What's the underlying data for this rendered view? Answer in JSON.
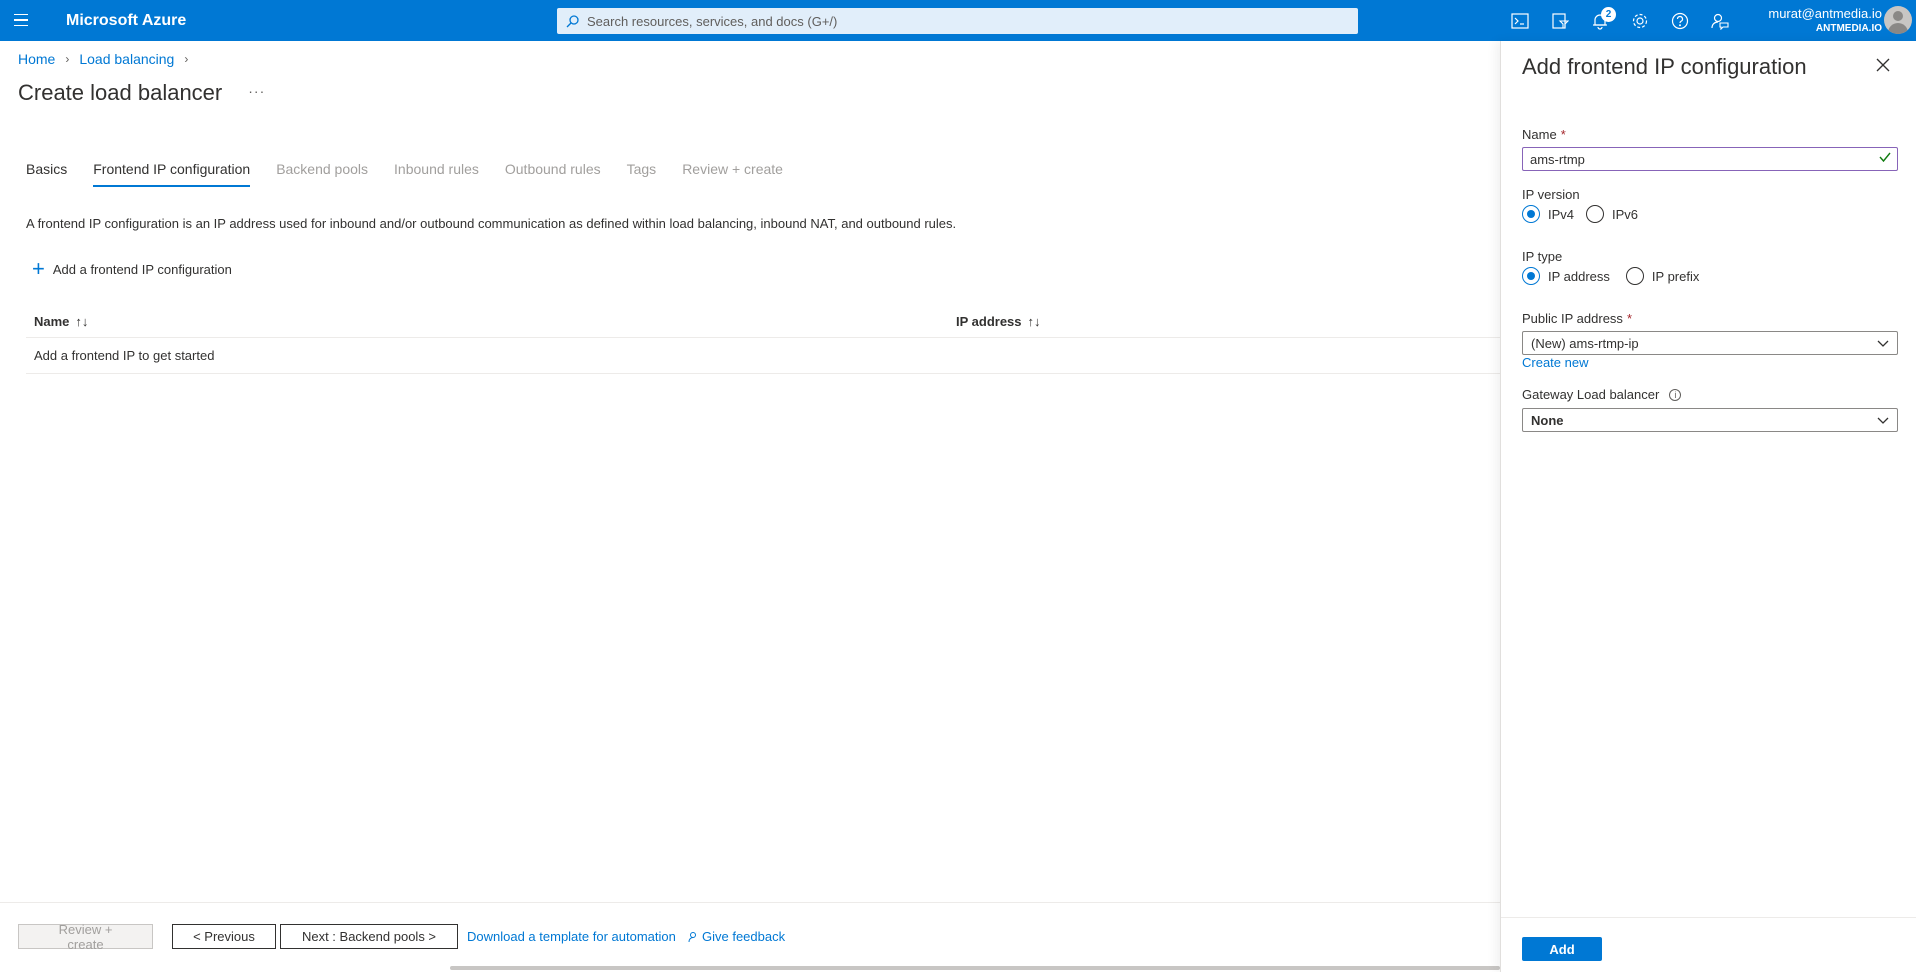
{
  "topbar": {
    "brand": "Microsoft Azure",
    "search_placeholder": "Search resources, services, and docs (G+/)",
    "notification_count": "2",
    "account_email": "murat@antmedia.io",
    "account_org": "ANTMEDIA.IO",
    "icons": [
      "cloud-shell-icon",
      "directory-filter-icon",
      "notifications-icon",
      "settings-icon",
      "help-icon",
      "feedback-icon"
    ]
  },
  "breadcrumb": {
    "items": [
      "Home",
      "Load balancing"
    ]
  },
  "page": {
    "title": "Create load balancer",
    "more": "···"
  },
  "tabs": [
    {
      "label": "Basics",
      "state": "enabled"
    },
    {
      "label": "Frontend IP configuration",
      "state": "active"
    },
    {
      "label": "Backend pools",
      "state": "disabled"
    },
    {
      "label": "Inbound rules",
      "state": "disabled"
    },
    {
      "label": "Outbound rules",
      "state": "disabled"
    },
    {
      "label": "Tags",
      "state": "disabled"
    },
    {
      "label": "Review + create",
      "state": "disabled"
    }
  ],
  "main": {
    "description": "A frontend IP configuration is an IP address used for inbound and/or outbound communication as defined within load balancing, inbound NAT, and outbound rules.",
    "add_label": "Add a frontend IP configuration",
    "grid": {
      "col_name": "Name",
      "col_ip": "IP address",
      "sort_glyph": "↑↓",
      "empty_text": "Add a frontend IP to get started"
    }
  },
  "footer": {
    "review": "Review + create",
    "previous": "< Previous",
    "next": "Next : Backend pools >",
    "template_link": "Download a template for automation",
    "feedback_link": "Give feedback"
  },
  "panel": {
    "title": "Add frontend IP configuration",
    "name_label": "Name",
    "required_mark": "*",
    "name_value": "ams-rtmp",
    "ip_version_label": "IP version",
    "ip_version_options": [
      "IPv4",
      "IPv6"
    ],
    "ip_version_selected": "IPv4",
    "ip_type_label": "IP type",
    "ip_type_options": [
      "IP address",
      "IP prefix"
    ],
    "ip_type_selected": "IP address",
    "public_ip_label": "Public IP address",
    "public_ip_value": "(New) ams-rtmp-ip",
    "create_new": "Create new",
    "gateway_label": "Gateway Load balancer",
    "gateway_value": "None",
    "add_button": "Add"
  },
  "colors": {
    "accent": "#0078d4",
    "valid_check": "#107c10",
    "required": "#a4262c"
  }
}
